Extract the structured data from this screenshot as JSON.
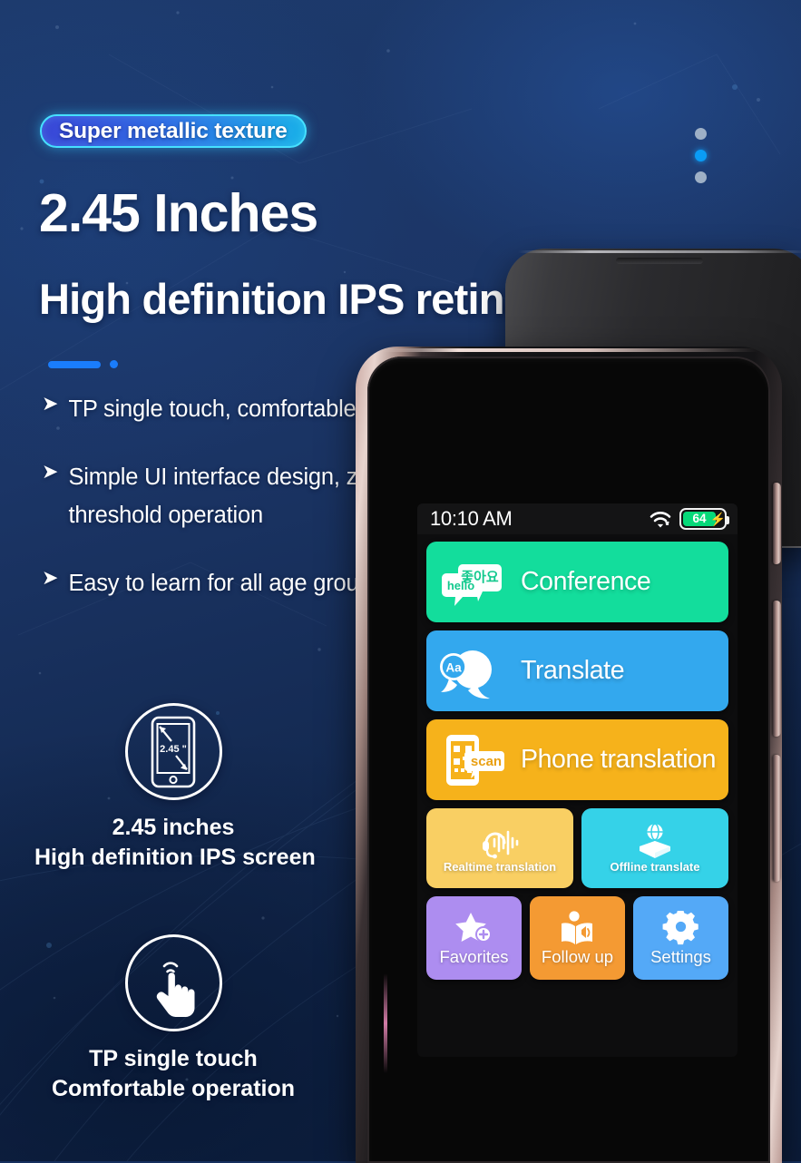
{
  "background": {
    "base_color": "#1b3566",
    "accent_blue": "#1a7dfc"
  },
  "pager": {
    "items": [
      {
        "active": false
      },
      {
        "active": true
      },
      {
        "active": false
      }
    ]
  },
  "badge": {
    "label": "Super metallic texture",
    "gradient_from": "#3a45d6",
    "gradient_to": "#19b2e8",
    "border": "#46e0ff"
  },
  "headings": {
    "title": "2.45 Inches",
    "subtitle": "High definition IPS retinal screen"
  },
  "bullets": [
    {
      "marker": "➤",
      "text": "TP single touch, comfortable to operate"
    },
    {
      "marker": "➤",
      "text": "Simple UI interface design, zero threshold operation"
    },
    {
      "marker": "➤",
      "text": "Easy to learn for all age groups"
    }
  ],
  "features": [
    {
      "icon": "phone-diagonal-icon",
      "inline_label": "2.45 \"",
      "caption_line1": "2.45 inches",
      "caption_line2": "High definition IPS screen"
    },
    {
      "icon": "touch-hand-icon",
      "inline_label": "",
      "caption_line1": "TP single touch",
      "caption_line2": "Comfortable operation"
    }
  ],
  "phone": {
    "status_bar": {
      "time": "10:10 AM",
      "wifi_icon": "wifi-icon",
      "battery": {
        "icon": "battery-icon",
        "percent": "64",
        "charging_icon": "⚡",
        "fill_color": "#06d979"
      }
    },
    "menu": {
      "wide_tiles": [
        {
          "label": "Conference",
          "color": "#13dd9c",
          "icon": "two-speech-bubbles-icon",
          "bubble_1_text": "hello",
          "bubble_2_text": "좋아요"
        },
        {
          "label": "Translate",
          "color": "#33a8ee",
          "icon": "speech-bubble-aa-icon",
          "bubble_text": "Aa"
        },
        {
          "label": "Phone translation",
          "color": "#f6b21b",
          "icon": "phone-qr-scan-icon",
          "bubble_text": "scan"
        }
      ],
      "medium_tiles": [
        {
          "label": "Realtime translation",
          "color": "#f9cf63",
          "icon": "headset-waveform-icon"
        },
        {
          "label": "Offline translate",
          "color": "#35d2e8",
          "icon": "open-box-globe-icon"
        }
      ],
      "small_tiles": [
        {
          "label": "Favorites",
          "color": "#ad8df0",
          "icon": "star-plus-icon"
        },
        {
          "label": "Follow up",
          "color": "#f49a33",
          "icon": "book-speaker-icon"
        },
        {
          "label": "Settings",
          "color": "#54a9f7",
          "icon": "gear-icon"
        }
      ]
    }
  }
}
